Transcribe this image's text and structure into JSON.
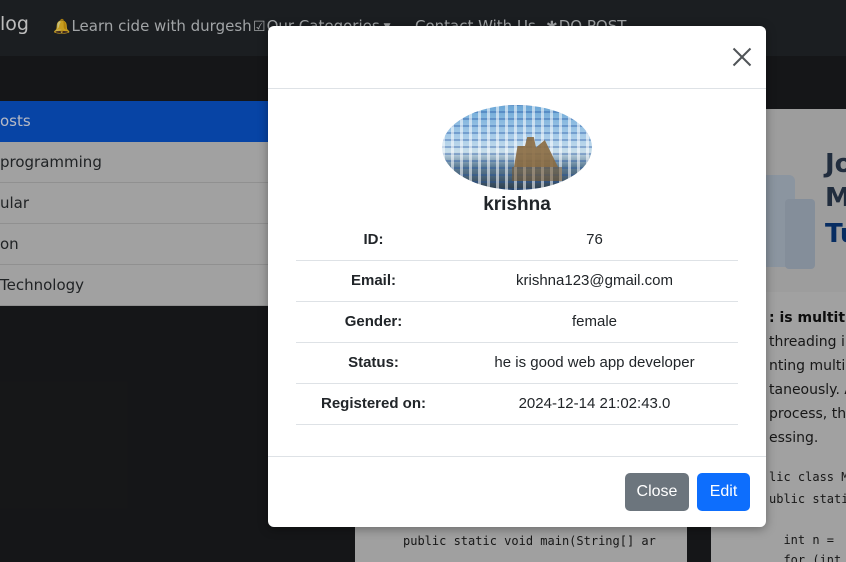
{
  "navbar": {
    "brand": "log",
    "links": [
      {
        "icon": "bell-icon",
        "glyph": "🔔",
        "label": "Learn cide with durgesh"
      },
      {
        "icon": "check-square-icon",
        "glyph": "☑",
        "label": "Our Categories"
      },
      {
        "icon": "",
        "glyph": "",
        "label": "Contact With Us"
      },
      {
        "icon": "asterisk-icon",
        "glyph": "✱",
        "label": "DO POST"
      }
    ]
  },
  "categories": [
    {
      "label": "osts",
      "active": true
    },
    {
      "label": " programming",
      "active": false
    },
    {
      "label": "ular",
      "active": false
    },
    {
      "label": "on",
      "active": false
    },
    {
      "label": " Technology",
      "active": false
    }
  ],
  "post_preview": {
    "image_lines": [
      "Jo",
      "M",
      "Tu"
    ],
    "title": ": is multithr",
    "lines": [
      "threading in",
      "nting multip",
      "taneously. A",
      "process, the",
      "essing."
    ],
    "code_lines": [
      "lic class M",
      "ublic stati",
      "",
      "  int n =",
      "  for (int"
    ]
  },
  "code_preview": {
    "line": "public static void main(String[] ar"
  },
  "modal": {
    "close_icon": "close-icon",
    "username": "krishna",
    "rows": [
      {
        "label": "ID:",
        "value": "76"
      },
      {
        "label": "Email:",
        "value": "krishna123@gmail.com"
      },
      {
        "label": "Gender:",
        "value": "female"
      },
      {
        "label": "Status:",
        "value": "he is good web app developer"
      },
      {
        "label": "Registered on:",
        "value": "2024-12-14 21:02:43.0"
      }
    ],
    "buttons": {
      "close": "Close",
      "edit": "Edit"
    },
    "colors": {
      "close": "#6c757d",
      "edit": "#0d6efd"
    }
  }
}
